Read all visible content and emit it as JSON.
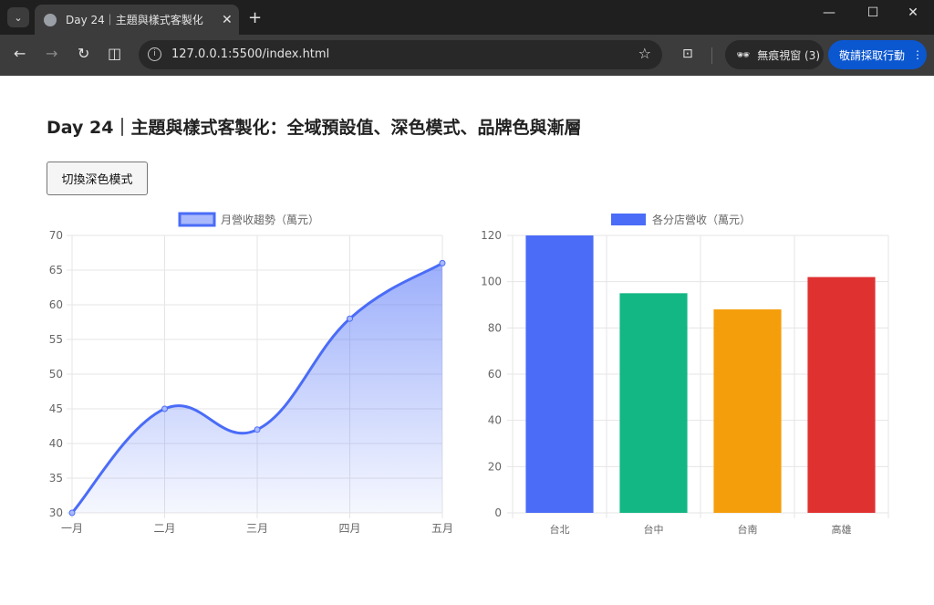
{
  "browser": {
    "tab_title": "Day 24｜主題與樣式客製化",
    "url": "127.0.0.1:5500/index.html",
    "incognito_label": "無痕視窗 (3)",
    "action_label": "敬請採取行動"
  },
  "page": {
    "title": "Day 24｜主題與樣式客製化：全域預設值、深色模式、品牌色與漸層",
    "toggle_button": "切換深色模式"
  },
  "chart_data": [
    {
      "type": "area",
      "legend": "月營收趨勢（萬元）",
      "categories": [
        "一月",
        "二月",
        "三月",
        "四月",
        "五月"
      ],
      "values": [
        30,
        45,
        42,
        58,
        66
      ],
      "ylim": [
        30,
        70
      ],
      "yticks": [
        30,
        35,
        40,
        45,
        50,
        55,
        60,
        65,
        70
      ],
      "color": "#4a6cf7",
      "legend_position": "top",
      "grid": true
    },
    {
      "type": "bar",
      "legend": "各分店營收（萬元）",
      "categories": [
        "台北",
        "台中",
        "台南",
        "高雄"
      ],
      "values": [
        120,
        95,
        88,
        102
      ],
      "ylim": [
        0,
        120
      ],
      "yticks": [
        0,
        20,
        40,
        60,
        80,
        100,
        120
      ],
      "colors": [
        "#4a6cf7",
        "#13b784",
        "#f59e0b",
        "#e03131"
      ],
      "legend_position": "top",
      "grid": true
    }
  ]
}
